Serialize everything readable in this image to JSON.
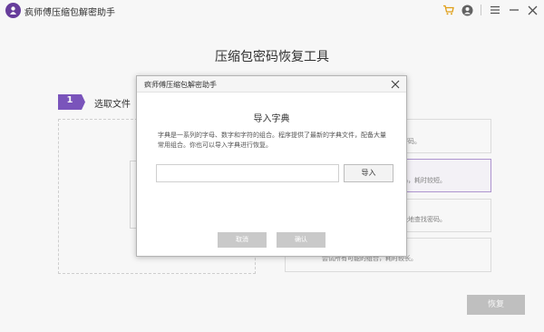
{
  "app": {
    "title": "疯师傅压缩包解密助手"
  },
  "titlebar": {
    "icons": [
      "cart-icon",
      "user-icon",
      "menu-icon",
      "minimize-icon",
      "close-icon"
    ],
    "accent_color": "#e8a417"
  },
  "main": {
    "title": "压缩包密码恢复工具",
    "step": {
      "number": "1",
      "label": "选取文件",
      "color": "#7e57c2"
    },
    "options": [
      {
        "text": "密码。"
      },
      {
        "text": "码，耗时较短。"
      },
      {
        "text": "快地查找密码。"
      },
      {
        "text": "尝试所有可能的组合，耗时较长。"
      }
    ],
    "restore_label": "恢复"
  },
  "dialog": {
    "title": "疯师傅压缩包解密助手",
    "heading": "导入字典",
    "description": "字典是一系列的字母、数字和字符的组合。程序提供了最新的字典文件，配备大量常用组合。你也可以导入字典进行恢复。",
    "input": {
      "value": "",
      "placeholder": ""
    },
    "import_label": "导入",
    "cancel_label": "取消",
    "ok_label": "确认"
  }
}
